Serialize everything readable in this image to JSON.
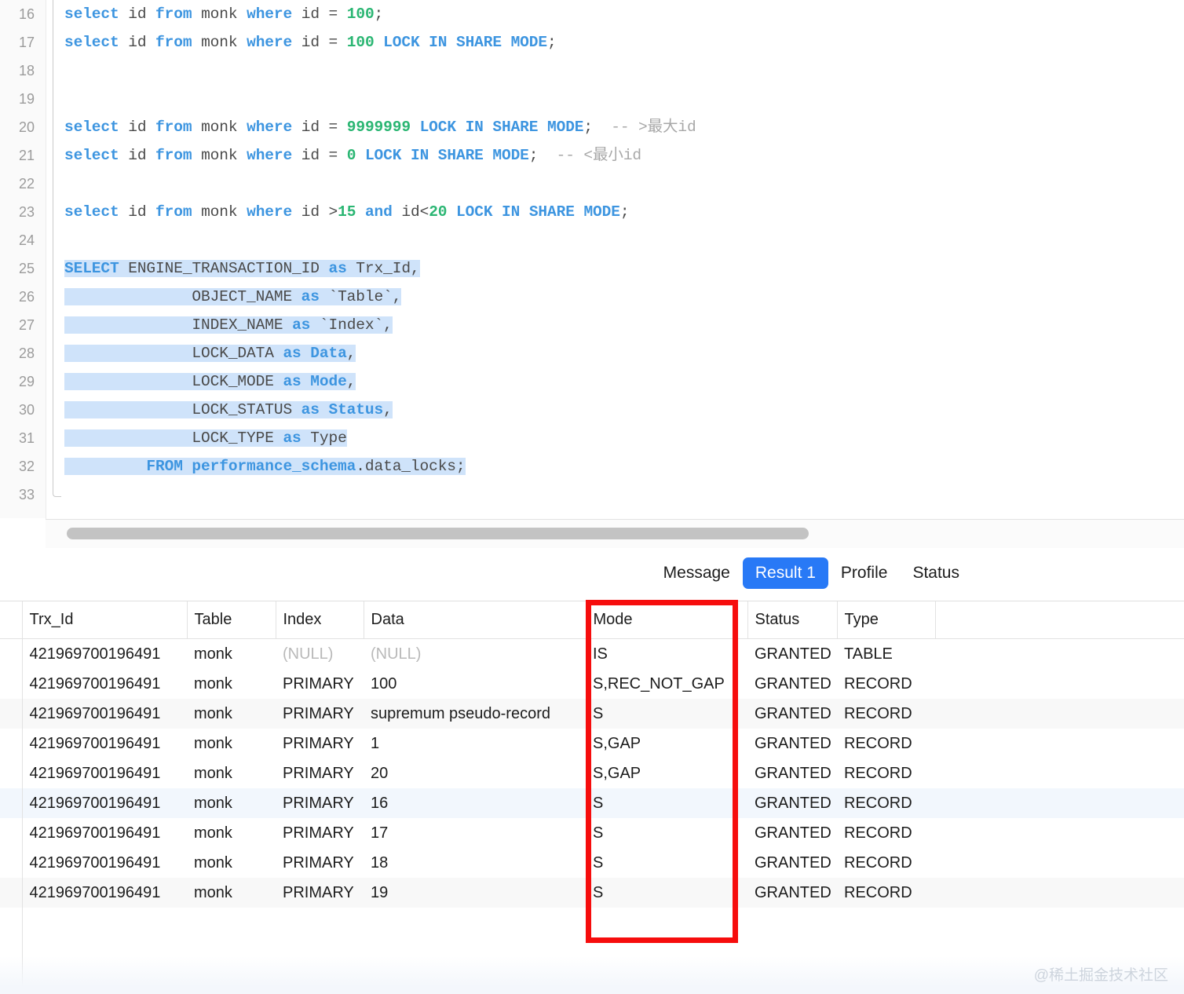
{
  "editor": {
    "first_line_number": 16,
    "lines": [
      {
        "n": 16,
        "tokens": [
          {
            "t": "select",
            "c": "kw"
          },
          {
            "t": " id ",
            "c": "id"
          },
          {
            "t": "from",
            "c": "kw"
          },
          {
            "t": " monk ",
            "c": "id"
          },
          {
            "t": "where",
            "c": "kw"
          },
          {
            "t": " id = ",
            "c": "id"
          },
          {
            "t": "100",
            "c": "num"
          },
          {
            "t": ";",
            "c": "id"
          }
        ]
      },
      {
        "n": 17,
        "tokens": [
          {
            "t": "select",
            "c": "kw"
          },
          {
            "t": " id ",
            "c": "id"
          },
          {
            "t": "from",
            "c": "kw"
          },
          {
            "t": " monk ",
            "c": "id"
          },
          {
            "t": "where",
            "c": "kw"
          },
          {
            "t": " id = ",
            "c": "id"
          },
          {
            "t": "100",
            "c": "num"
          },
          {
            "t": " ",
            "c": "id"
          },
          {
            "t": "LOCK IN SHARE MODE",
            "c": "kw"
          },
          {
            "t": ";",
            "c": "id"
          }
        ]
      },
      {
        "n": 18,
        "tokens": []
      },
      {
        "n": 19,
        "tokens": []
      },
      {
        "n": 20,
        "tokens": [
          {
            "t": "select",
            "c": "kw"
          },
          {
            "t": " id ",
            "c": "id"
          },
          {
            "t": "from",
            "c": "kw"
          },
          {
            "t": " monk ",
            "c": "id"
          },
          {
            "t": "where",
            "c": "kw"
          },
          {
            "t": " id = ",
            "c": "id"
          },
          {
            "t": "9999999",
            "c": "num"
          },
          {
            "t": " ",
            "c": "id"
          },
          {
            "t": "LOCK IN SHARE MODE",
            "c": "kw"
          },
          {
            "t": ";",
            "c": "id"
          },
          {
            "t": "  -- >最大id",
            "c": "cmt"
          }
        ]
      },
      {
        "n": 21,
        "tokens": [
          {
            "t": "select",
            "c": "kw"
          },
          {
            "t": " id ",
            "c": "id"
          },
          {
            "t": "from",
            "c": "kw"
          },
          {
            "t": " monk ",
            "c": "id"
          },
          {
            "t": "where",
            "c": "kw"
          },
          {
            "t": " id = ",
            "c": "id"
          },
          {
            "t": "0",
            "c": "num"
          },
          {
            "t": " ",
            "c": "id"
          },
          {
            "t": "LOCK IN SHARE MODE",
            "c": "kw"
          },
          {
            "t": ";",
            "c": "id"
          },
          {
            "t": "  -- <最小id",
            "c": "cmt"
          }
        ]
      },
      {
        "n": 22,
        "tokens": []
      },
      {
        "n": 23,
        "tokens": [
          {
            "t": "select",
            "c": "kw"
          },
          {
            "t": " id ",
            "c": "id"
          },
          {
            "t": "from",
            "c": "kw"
          },
          {
            "t": " monk ",
            "c": "id"
          },
          {
            "t": "where",
            "c": "kw"
          },
          {
            "t": " id >",
            "c": "id"
          },
          {
            "t": "15",
            "c": "num"
          },
          {
            "t": " ",
            "c": "id"
          },
          {
            "t": "and",
            "c": "kw"
          },
          {
            "t": " id<",
            "c": "id"
          },
          {
            "t": "20",
            "c": "num"
          },
          {
            "t": " ",
            "c": "id"
          },
          {
            "t": "LOCK IN SHARE MODE",
            "c": "kw"
          },
          {
            "t": ";",
            "c": "id"
          }
        ]
      },
      {
        "n": 24,
        "tokens": []
      },
      {
        "n": 25,
        "selected": true,
        "tokens": [
          {
            "t": "SELECT",
            "c": "kw"
          },
          {
            "t": " ENGINE_TRANSACTION_ID ",
            "c": "id"
          },
          {
            "t": "as",
            "c": "kw"
          },
          {
            "t": " Trx_Id,",
            "c": "id"
          }
        ]
      },
      {
        "n": 26,
        "selected": true,
        "tokens": [
          {
            "t": "              OBJECT_NAME ",
            "c": "id"
          },
          {
            "t": "as",
            "c": "kw"
          },
          {
            "t": " `Table`,",
            "c": "id"
          }
        ]
      },
      {
        "n": 27,
        "selected": true,
        "tokens": [
          {
            "t": "              INDEX_NAME ",
            "c": "id"
          },
          {
            "t": "as",
            "c": "kw"
          },
          {
            "t": " `Index`,",
            "c": "id"
          }
        ]
      },
      {
        "n": 28,
        "selected": true,
        "tokens": [
          {
            "t": "              LOCK_DATA ",
            "c": "id"
          },
          {
            "t": "as Data",
            "c": "kw"
          },
          {
            "t": ",",
            "c": "id"
          }
        ]
      },
      {
        "n": 29,
        "selected": true,
        "tokens": [
          {
            "t": "              LOCK_MODE ",
            "c": "id"
          },
          {
            "t": "as Mode",
            "c": "kw"
          },
          {
            "t": ",",
            "c": "id"
          }
        ]
      },
      {
        "n": 30,
        "selected": true,
        "tokens": [
          {
            "t": "              LOCK_STATUS ",
            "c": "id"
          },
          {
            "t": "as Status",
            "c": "kw"
          },
          {
            "t": ",",
            "c": "id"
          }
        ]
      },
      {
        "n": 31,
        "selected": true,
        "tokens": [
          {
            "t": "              LOCK_TYPE ",
            "c": "id"
          },
          {
            "t": "as",
            "c": "kw"
          },
          {
            "t": " Type",
            "c": "id"
          }
        ]
      },
      {
        "n": 32,
        "selected": true,
        "tokens": [
          {
            "t": "         ",
            "c": "id"
          },
          {
            "t": "FROM performance_schema",
            "c": "kw"
          },
          {
            "t": ".data_locks;",
            "c": "id"
          }
        ]
      },
      {
        "n": 33,
        "tokens": []
      }
    ]
  },
  "tabs": [
    {
      "label": "Message",
      "active": false
    },
    {
      "label": "Result 1",
      "active": true
    },
    {
      "label": "Profile",
      "active": false
    },
    {
      "label": "Status",
      "active": false
    }
  ],
  "result_table": {
    "columns": [
      "Trx_Id",
      "Table",
      "Index",
      "Data",
      "Mode",
      "Status",
      "Type"
    ],
    "rows": [
      {
        "stripe": "white",
        "cells": [
          "421969700196491",
          "monk",
          "(NULL)",
          "(NULL)",
          "IS",
          "GRANTED",
          "TABLE"
        ]
      },
      {
        "stripe": "white",
        "cells": [
          "421969700196491",
          "monk",
          "PRIMARY",
          "100",
          "S,REC_NOT_GAP",
          "GRANTED",
          "RECORD"
        ]
      },
      {
        "stripe": "gray",
        "cells": [
          "421969700196491",
          "monk",
          "PRIMARY",
          "supremum pseudo-record",
          "S",
          "GRANTED",
          "RECORD"
        ]
      },
      {
        "stripe": "white",
        "cells": [
          "421969700196491",
          "monk",
          "PRIMARY",
          "1",
          "S,GAP",
          "GRANTED",
          "RECORD"
        ]
      },
      {
        "stripe": "white",
        "cells": [
          "421969700196491",
          "monk",
          "PRIMARY",
          "20",
          "S,GAP",
          "GRANTED",
          "RECORD"
        ]
      },
      {
        "stripe": "blue",
        "cells": [
          "421969700196491",
          "monk",
          "PRIMARY",
          "16",
          "S",
          "GRANTED",
          "RECORD"
        ]
      },
      {
        "stripe": "white",
        "cells": [
          "421969700196491",
          "monk",
          "PRIMARY",
          "17",
          "S",
          "GRANTED",
          "RECORD"
        ]
      },
      {
        "stripe": "white",
        "cells": [
          "421969700196491",
          "monk",
          "PRIMARY",
          "18",
          "S",
          "GRANTED",
          "RECORD"
        ]
      },
      {
        "stripe": "gray",
        "cells": [
          "421969700196491",
          "monk",
          "PRIMARY",
          "19",
          "S",
          "GRANTED",
          "RECORD"
        ]
      }
    ]
  },
  "annotation": {
    "highlight_column": "Mode",
    "color": "#f60d0d"
  },
  "watermark": "@稀土掘金技术社区",
  "colors": {
    "keyword": "#3d95e0",
    "number": "#2bb673",
    "comment": "#a8a8a8",
    "selection": "#cfe3fa",
    "tab_active": "#2879f6"
  }
}
